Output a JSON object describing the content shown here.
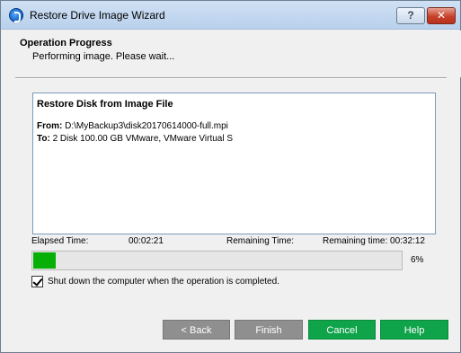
{
  "window": {
    "title": "Restore Drive Image Wizard",
    "help_button": "?",
    "close_button": "✕"
  },
  "header": {
    "title": "Operation Progress",
    "subtitle": "Performing image. Please wait..."
  },
  "info": {
    "title": "Restore Disk from Image File",
    "from_label": "From:",
    "from_value": " D:\\MyBackup3\\disk20170614000-full.mpi",
    "to_label": "To:",
    "to_value": " 2 Disk 100.00 GB VMware, VMware Virtual S"
  },
  "timing": {
    "elapsed_label": "Elapsed Time:",
    "elapsed_value": "00:02:21",
    "remaining_label": "Remaining Time:",
    "remaining_value": "Remaining time: 00:32:12"
  },
  "progress": {
    "percent_text": "6%",
    "fraction": 0.06,
    "color": "#06b006"
  },
  "shutdown_option": {
    "label": "Shut down the computer when the operation is completed.",
    "checked": true
  },
  "buttons": {
    "back": "< Back",
    "finish": "Finish",
    "cancel": "Cancel",
    "help": "Help"
  },
  "colors": {
    "accent_green": "#0fa34a",
    "disabled_gray": "#8f8f8f"
  }
}
